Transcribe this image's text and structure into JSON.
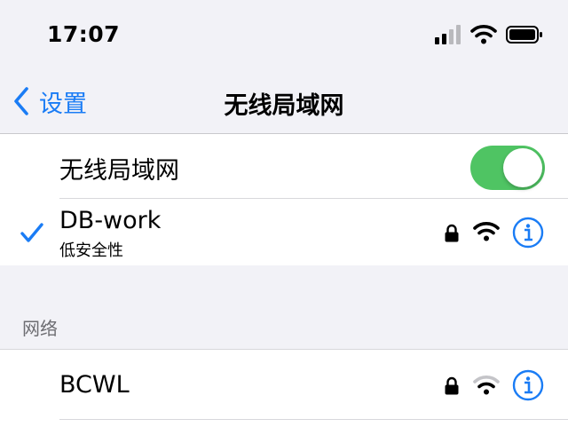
{
  "status_bar": {
    "time": "17:07",
    "signal_bars_active": 2,
    "signal_bars_total": 4
  },
  "nav": {
    "back_label": "设置",
    "title": "无线局域网"
  },
  "wifi_toggle": {
    "label": "无线局域网",
    "enabled": true
  },
  "connected_network": {
    "name": "DB-work",
    "subtitle": "低安全性",
    "secured": true,
    "icons": [
      "checkmark-icon",
      "lock-icon",
      "wifi-icon",
      "info-icon"
    ]
  },
  "networks_section": {
    "header": "网络",
    "items": [
      {
        "name": "BCWL",
        "secured": true,
        "icons": [
          "lock-icon",
          "wifi-icon",
          "info-icon"
        ]
      }
    ]
  },
  "colors": {
    "accent": "#1a7cf5",
    "toggle_on": "#4fc463",
    "background": "#f2f2f7"
  }
}
